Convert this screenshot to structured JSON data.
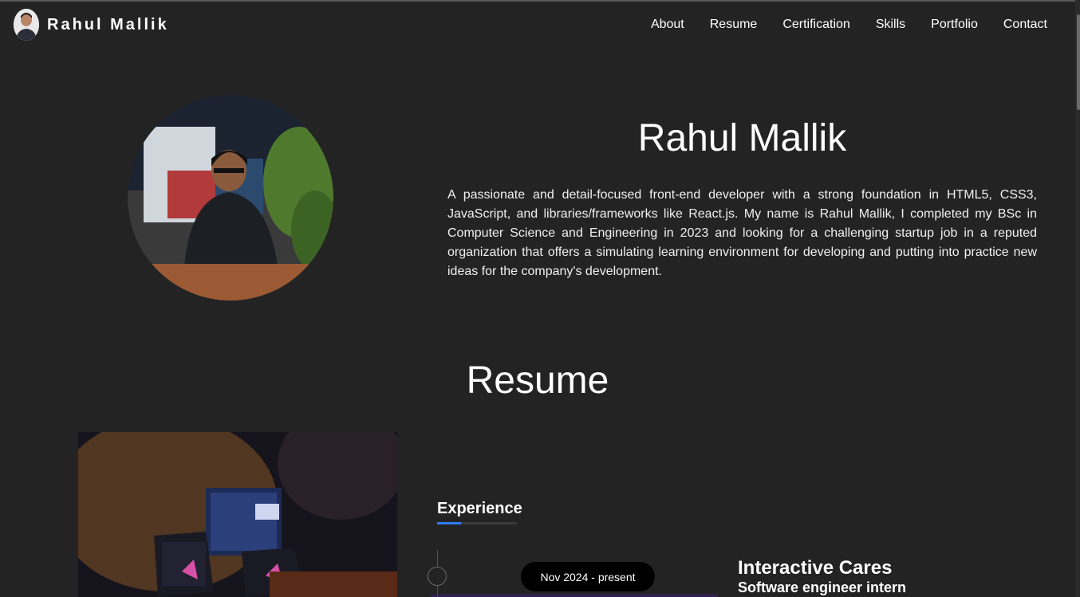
{
  "header": {
    "brand_name": "Rahul Mallik",
    "nav": [
      "About",
      "Resume",
      "Certification",
      "Skills",
      "Portfolio",
      "Contact"
    ]
  },
  "hero": {
    "name": "Rahul Mallik",
    "bio": "A passionate and detail-focused front-end developer with a strong foundation in HTML5, CSS3, JavaScript, and libraries/frameworks like React.js. My name is Rahul Mallik, I completed my BSc in Computer Science and Engineering in 2023 and looking for a challenging startup job in a reputed organization that offers a simulating learning environment for developing and putting into practice new ideas for the company's development."
  },
  "resume": {
    "title": "Resume",
    "experience_heading": "Experience",
    "entries": [
      {
        "date": "Nov 2024 - present",
        "company": "Interactive Cares",
        "role": "Software engineer intern"
      }
    ]
  },
  "colors": {
    "background": "#232323",
    "accent": "#2f7bff",
    "pill": "#000000"
  }
}
